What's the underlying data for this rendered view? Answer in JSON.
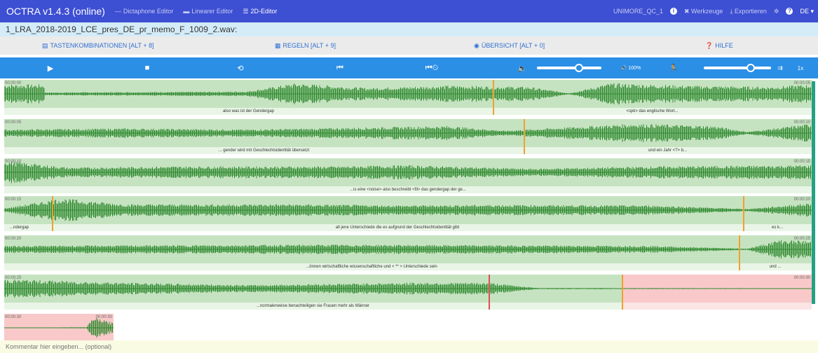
{
  "navbar": {
    "brand": "OCTRA v1.4.3 (online)",
    "editors": [
      {
        "label": "Dictaphone Editor",
        "icon": "minus-icon",
        "active": false
      },
      {
        "label": "Linearer Editor",
        "icon": "window-icon",
        "active": false
      },
      {
        "label": "2D-Editor",
        "icon": "list-icon",
        "active": true
      }
    ],
    "project": "UNIMORE_QC_1",
    "tools_label": "Werkzeuge",
    "export_label": "Exportieren",
    "language": "DE"
  },
  "file": {
    "name": "1_LRA_2018-2019_LCE_pres_DE_pr_memo_F_1009_2.wav:"
  },
  "shortcuts": {
    "keys": "TASTENKOMBINATIONEN [ALT + 8]",
    "rules": "REGELN [ALT + 9]",
    "overview": "ÜBERSICHT [ALT + 0]",
    "help": "HILFE"
  },
  "player": {
    "icons": [
      "play-icon",
      "stop-icon",
      "repeat-icon",
      "step-backward-icon",
      "backward-time-icon",
      "volume-icon"
    ],
    "volume_level": 0.65,
    "speed_label": "100%",
    "speed_level": 0.7,
    "speed_value": "1x"
  },
  "lines": [
    {
      "start": "00:00:00",
      "end": "00:00:05",
      "labels": [
        "also was ist der Gendergap",
        "<spk> das englische Wort..."
      ]
    },
    {
      "start": "00:00:05",
      "end": "00:00:10",
      "labels": [
        "... gender wird mit Geschlechtsidentität übersetzt",
        "und ein Jahr <?> b..."
      ]
    },
    {
      "start": "00:00:10",
      "end": "00:00:15",
      "labels": [
        "...is eine <noise> also beschreibt <fil> das gendergap der ge..."
      ]
    },
    {
      "start": "00:00:15",
      "end": "00:00:20",
      "labels": [
        "...ndergap",
        "all jene Unterschiede die es aufgrund der Geschlechtsidentität gibt",
        "es k..."
      ]
    },
    {
      "start": "00:00:20",
      "end": "00:00:25",
      "labels": [
        "...önnen wirtschaftliche wissenschaftliche und < ** > Unterschiede sein",
        "und ..."
      ]
    },
    {
      "start": "00:00:25",
      "end": "00:00:30",
      "labels": [
        "...normalerweise benachteiligen sie Frauen mehr als Männer"
      ]
    },
    {
      "start": "00:00:30",
      "end": "00:00:30",
      "labels": []
    }
  ],
  "comment": {
    "placeholder": "Kommentar hier eingeben... (optional)"
  },
  "colors": {
    "navbar": "#3d4fd2",
    "player": "#2b8fe6",
    "segment": "#c6e3c1",
    "segment_empty": "#f9c9c9",
    "wave": "#2f8a2f",
    "boundary": "#f0a030"
  }
}
